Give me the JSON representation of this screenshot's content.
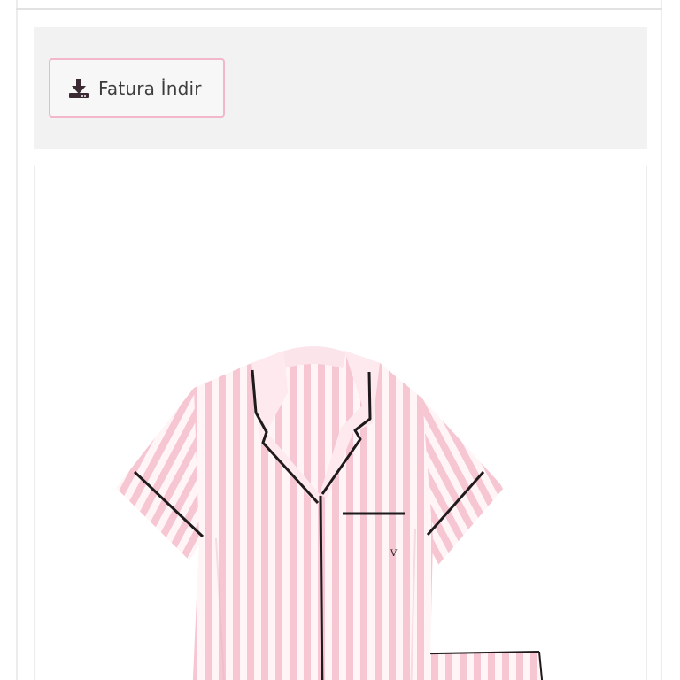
{
  "invoice": {
    "download_label": "Fatura İndir",
    "icon": "download-icon"
  },
  "product": {
    "image_subject": "pink-white-striped-satin-pajama-set",
    "colors": {
      "stripe_pink": "#f6c6d2",
      "stripe_white": "#fff5f7",
      "piping": "#1f1a1c"
    }
  },
  "colors": {
    "panel_bg": "#f2f2f2",
    "button_border": "#f2b7c9",
    "text_dark": "#3d3d3d",
    "icon_color": "#3b2a33"
  }
}
